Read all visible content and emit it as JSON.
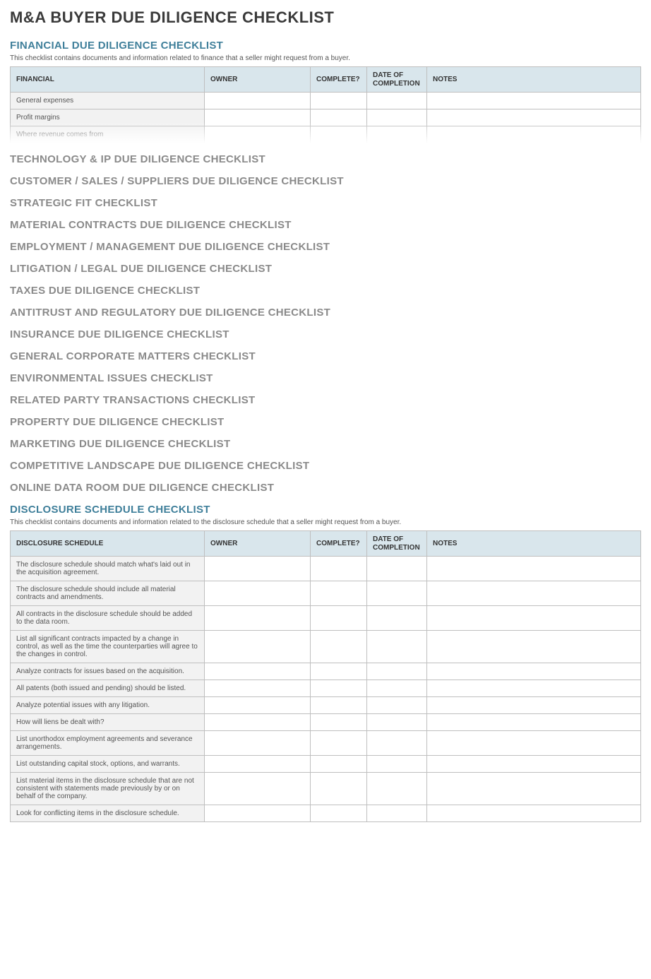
{
  "main_title": "M&A BUYER DUE DILIGENCE CHECKLIST",
  "financial": {
    "heading": "FINANCIAL DUE DILIGENCE CHECKLIST",
    "desc": "This checklist contains documents and information related to finance that a seller might request from a buyer.",
    "columns": {
      "item": "FINANCIAL",
      "owner": "OWNER",
      "complete": "COMPLETE?",
      "date": "DATE OF COMPLETION",
      "notes": "NOTES"
    },
    "rows": [
      {
        "item": "General expenses",
        "owner": "",
        "complete": "",
        "date": "",
        "notes": ""
      },
      {
        "item": "Profit margins",
        "owner": "",
        "complete": "",
        "date": "",
        "notes": ""
      },
      {
        "item": "Where revenue comes from",
        "owner": "",
        "complete": "",
        "date": "",
        "notes": ""
      }
    ]
  },
  "collapsed_sections": [
    "TECHNOLOGY & IP DUE DILIGENCE CHECKLIST",
    "CUSTOMER / SALES / SUPPLIERS DUE DILIGENCE CHECKLIST",
    "STRATEGIC FIT CHECKLIST",
    "MATERIAL CONTRACTS DUE DILIGENCE CHECKLIST",
    "EMPLOYMENT / MANAGEMENT DUE DILIGENCE CHECKLIST",
    "LITIGATION / LEGAL DUE DILIGENCE CHECKLIST",
    "TAXES DUE DILIGENCE CHECKLIST",
    "ANTITRUST AND REGULATORY DUE DILIGENCE CHECKLIST",
    "INSURANCE DUE DILIGENCE CHECKLIST",
    "GENERAL CORPORATE MATTERS CHECKLIST",
    "ENVIRONMENTAL ISSUES CHECKLIST",
    "RELATED PARTY TRANSACTIONS CHECKLIST",
    "PROPERTY DUE DILIGENCE CHECKLIST",
    "MARKETING DUE DILIGENCE CHECKLIST",
    "COMPETITIVE LANDSCAPE DUE DILIGENCE CHECKLIST",
    "ONLINE DATA ROOM DUE DILIGENCE CHECKLIST"
  ],
  "disclosure": {
    "heading": "DISCLOSURE SCHEDULE CHECKLIST",
    "desc": "This checklist contains documents and information related to the disclosure schedule that a seller might request from a buyer.",
    "columns": {
      "item": "DISCLOSURE SCHEDULE",
      "owner": "OWNER",
      "complete": "COMPLETE?",
      "date": "DATE OF COMPLETION",
      "notes": "NOTES"
    },
    "rows": [
      {
        "item": "The disclosure schedule should match what's laid out in the acquisition agreement.",
        "owner": "",
        "complete": "",
        "date": "",
        "notes": ""
      },
      {
        "item": "The disclosure schedule should include all material contracts and amendments.",
        "owner": "",
        "complete": "",
        "date": "",
        "notes": ""
      },
      {
        "item": "All contracts in the disclosure schedule should be added to the data room.",
        "owner": "",
        "complete": "",
        "date": "",
        "notes": ""
      },
      {
        "item": "List all significant contracts impacted by a change in control, as well as the time the counterparties will agree to the changes in control.",
        "owner": "",
        "complete": "",
        "date": "",
        "notes": ""
      },
      {
        "item": "Analyze contracts for issues based on the acquisition.",
        "owner": "",
        "complete": "",
        "date": "",
        "notes": ""
      },
      {
        "item": "All patents (both issued and pending) should be listed.",
        "owner": "",
        "complete": "",
        "date": "",
        "notes": ""
      },
      {
        "item": "Analyze potential issues with any litigation.",
        "owner": "",
        "complete": "",
        "date": "",
        "notes": ""
      },
      {
        "item": "How will liens be dealt with?",
        "owner": "",
        "complete": "",
        "date": "",
        "notes": ""
      },
      {
        "item": "List unorthodox employment agreements and severance arrangements.",
        "owner": "",
        "complete": "",
        "date": "",
        "notes": ""
      },
      {
        "item": "List outstanding capital stock, options, and warrants.",
        "owner": "",
        "complete": "",
        "date": "",
        "notes": ""
      },
      {
        "item": "List material items in the disclosure schedule that are not consistent with statements made previously by or on behalf of the company.",
        "owner": "",
        "complete": "",
        "date": "",
        "notes": ""
      },
      {
        "item": "Look for conflicting items in the disclosure schedule.",
        "owner": "",
        "complete": "",
        "date": "",
        "notes": ""
      }
    ]
  }
}
